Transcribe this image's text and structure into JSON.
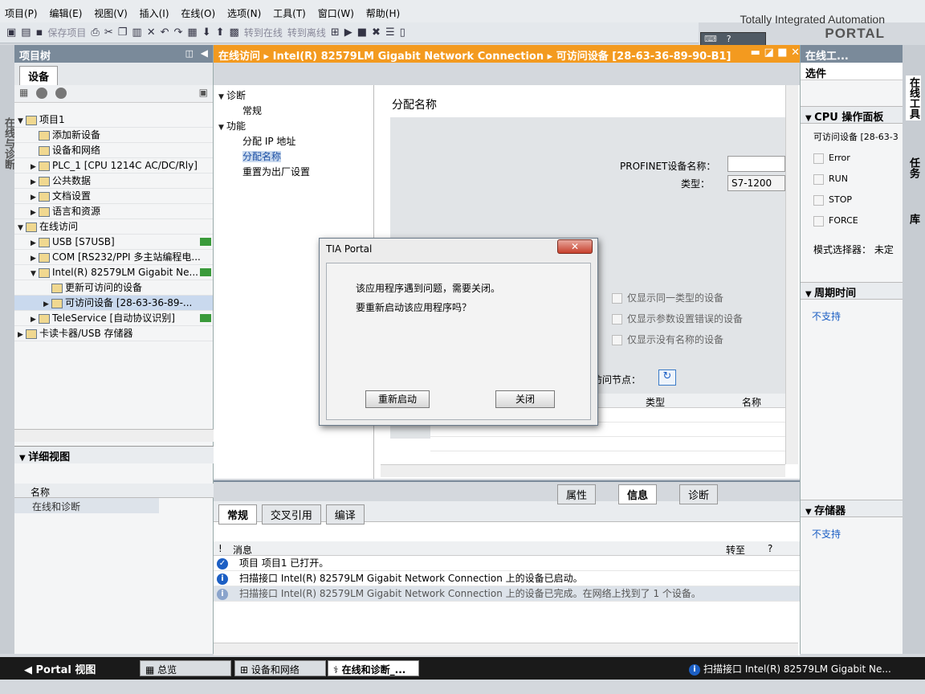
{
  "menu": [
    "项目(P)",
    "编辑(E)",
    "视图(V)",
    "插入(I)",
    "在线(O)",
    "选项(N)",
    "工具(T)",
    "窗口(W)",
    "帮助(H)"
  ],
  "toolbar": {
    "save": "保存项目",
    "go_online": "转到在线",
    "go_offline": "转到离线"
  },
  "brand": {
    "line1": "Totally Integrated Automation",
    "line2": "PORTAL"
  },
  "left": {
    "title": "项目树",
    "vertical_tab": "在线与诊断",
    "devices_tab": "设备",
    "tree": [
      {
        "label": "项目1",
        "level": 0,
        "fold": "▼"
      },
      {
        "label": "添加新设备",
        "level": 1,
        "fold": ""
      },
      {
        "label": "设备和网络",
        "level": 1,
        "fold": ""
      },
      {
        "label": "PLC_1 [CPU 1214C AC/DC/Rly]",
        "level": 1,
        "fold": "▶"
      },
      {
        "label": "公共数据",
        "level": 1,
        "fold": "▶"
      },
      {
        "label": "文档设置",
        "level": 1,
        "fold": "▶"
      },
      {
        "label": "语言和资源",
        "level": 1,
        "fold": "▶"
      },
      {
        "label": "在线访问",
        "level": 0,
        "fold": "▼"
      },
      {
        "label": "USB [S7USB]",
        "level": 1,
        "fold": "▶"
      },
      {
        "label": "COM [RS232/PPI 多主站编程电...",
        "level": 1,
        "fold": "▶"
      },
      {
        "label": "Intel(R) 82579LM Gigabit Ne...",
        "level": 1,
        "fold": "▼"
      },
      {
        "label": "更新可访问的设备",
        "level": 2,
        "fold": ""
      },
      {
        "label": "可访问设备 [28-63-36-89-...",
        "level": 2,
        "fold": "▶"
      },
      {
        "label": "TeleService [自动协议识别]",
        "level": 1,
        "fold": "▶"
      },
      {
        "label": "卡读卡器/USB 存储器",
        "level": 0,
        "fold": "▶"
      }
    ],
    "detail_title": "详细视图",
    "detail_col": "名称",
    "detail_item": "在线和诊断"
  },
  "center": {
    "breadcrumb": [
      "在线访问",
      "Intel(R) 82579LM Gigabit Network Connection",
      "可访问设备 [28-63-36-89-90-B1]"
    ],
    "nav": [
      {
        "label": "诊断",
        "fold": "▼",
        "level": 0
      },
      {
        "label": "常规",
        "fold": "",
        "level": 1
      },
      {
        "label": "功能",
        "fold": "▼",
        "level": 0
      },
      {
        "label": "分配 IP 地址",
        "fold": "",
        "level": 1
      },
      {
        "label": "分配名称",
        "fold": "",
        "level": 1
      },
      {
        "label": "重置为出厂设置",
        "fold": "",
        "level": 1
      }
    ],
    "section_title": "分配名称",
    "profinet_label": "PROFINET设备名称：",
    "type_label": "类型：",
    "type_value": "S7-1200",
    "filters": [
      "仅显示同一类型的设备",
      "仅显示参数设置错误的设备",
      "仅显示没有名称的设备"
    ],
    "accessible_nodes": "可访问节点：",
    "grid_cols": [
      "类型",
      "名称"
    ]
  },
  "inspector": {
    "tabs_right": [
      "属性",
      "信息",
      "诊断"
    ],
    "tabs_left": [
      "常规",
      "交叉引用",
      "编译"
    ],
    "col_msg": "消息",
    "col_goto": "转至",
    "col_q": "?",
    "messages": [
      "项目 项目1 已打开。",
      "扫描接口 Intel(R) 82579LM Gigabit Network Connection 上的设备已启动。",
      "扫描接口 Intel(R) 82579LM Gigabit Network Connection 上的设备已完成。在网络上找到了 1 个设备。"
    ]
  },
  "right": {
    "title": "在线工...",
    "options": "选件",
    "cpu_panel": "CPU 操作面板",
    "device": "可访问设备 [28-63-3",
    "leds": [
      "Error",
      "RUN",
      "STOP",
      "FORCE"
    ],
    "mode_label": "模式选择器：",
    "mode_value": "未定",
    "cycle": "周期时间",
    "cycle_val": "不支持",
    "memory": "存储器",
    "memory_val": "不支持",
    "vtabs": [
      "在线工具",
      "任务",
      "库"
    ]
  },
  "dialog": {
    "title": "TIA Portal",
    "line1": "该应用程序遇到问题，需要关闭。",
    "line2": "要重新启动该应用程序吗？",
    "restart": "重新启动",
    "close": "关闭"
  },
  "taskbar": {
    "portal": "Portal 视图",
    "items": [
      "总览",
      "设备和网络",
      "在线和诊断_..."
    ],
    "status": "扫描接口 Intel(R) 82579LM Gigabit Ne..."
  }
}
